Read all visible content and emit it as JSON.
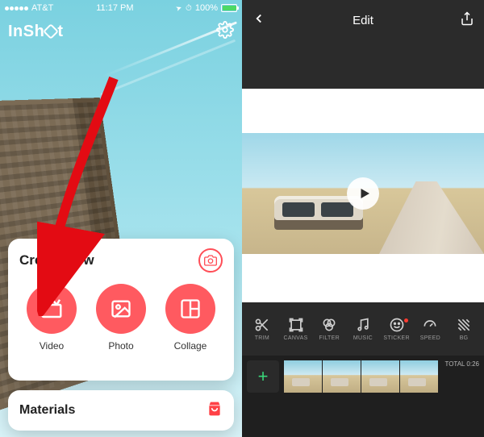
{
  "left": {
    "status": {
      "carrier": "AT&T",
      "time": "11:17 PM",
      "locationIcon": "➤",
      "alarmIcon": "⏰",
      "batteryPct": "100%"
    },
    "appName": "InShot",
    "settingsIcon": "gear",
    "createCard": {
      "title": "Create New",
      "cameraIcon": "camera",
      "options": [
        {
          "icon": "clapper",
          "label": "Video"
        },
        {
          "icon": "photo",
          "label": "Photo"
        },
        {
          "icon": "collage",
          "label": "Collage"
        }
      ]
    },
    "materialsCard": {
      "title": "Materials",
      "icon": "shopping-bag"
    }
  },
  "right": {
    "header": {
      "title": "Edit"
    },
    "player": {
      "icon": "play"
    },
    "tools": [
      {
        "icon": "trim",
        "label": "TRIM"
      },
      {
        "icon": "canvas",
        "label": "CANVAS"
      },
      {
        "icon": "filter",
        "label": "FILTER"
      },
      {
        "icon": "music",
        "label": "MUSIC"
      },
      {
        "icon": "sticker",
        "label": "STICKER",
        "dot": true
      },
      {
        "icon": "speed",
        "label": "SPEED"
      },
      {
        "icon": "bg",
        "label": "BG"
      }
    ],
    "timeline": {
      "addIcon": "+",
      "total": "TOTAL 0:26"
    }
  }
}
